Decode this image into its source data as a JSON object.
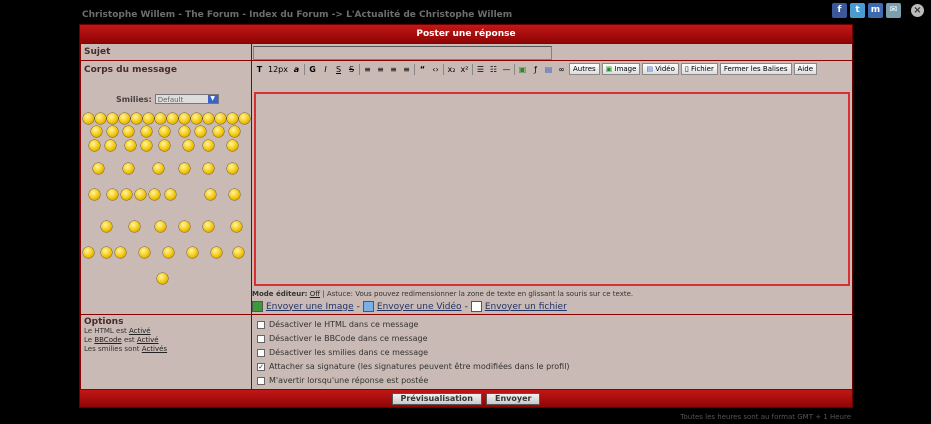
{
  "breadcrumb": "Christophe Willem - The Forum - Index du Forum -> L'Actualité de Christophe Willem",
  "social": [
    {
      "icon": "facebook-icon",
      "glyph": "f",
      "color": "#3b5998"
    },
    {
      "icon": "twitter-icon",
      "glyph": "t",
      "color": "#4a9bd1"
    },
    {
      "icon": "myspace-icon",
      "glyph": "m",
      "color": "#3c6bb4"
    },
    {
      "icon": "mail-icon",
      "glyph": "✉",
      "color": "#7aa0b0"
    }
  ],
  "header": {
    "title": "Poster une réponse"
  },
  "sujet": {
    "label": "Sujet",
    "value": ""
  },
  "corps": {
    "label": "Corps du message"
  },
  "smilies": {
    "label": "Smilies:",
    "selected": "Default"
  },
  "toolbar": {
    "size": "12px",
    "buttons": [
      "Autres",
      "Image",
      "Vidéo",
      "Fichier",
      "Fermer les Balises",
      "Aide"
    ]
  },
  "editor": {
    "mode_label": "Mode éditeur:",
    "mode_value": "Off",
    "tip": "| Astuce: Vous pouvez redimensionner la zone de texte en glissant la souris sur ce texte."
  },
  "uploads": {
    "image": "Envoyer une Image",
    "video": "Envoyer une Vidéo",
    "file": "Envoyer un fichier",
    "sep": "-"
  },
  "options": {
    "title": "Options",
    "html_prefix": "Le HTML est",
    "html_state": "Activé",
    "bbcode_prefix": "Le",
    "bbcode_link": "BBCode",
    "bbcode_mid": "est",
    "bbcode_state": "Activé",
    "smilies_prefix": "Les smilies sont",
    "smilies_state": "Activés",
    "checks": [
      {
        "label": "Désactiver le HTML dans ce message",
        "checked": false
      },
      {
        "label": "Désactiver le BBCode dans ce message",
        "checked": false
      },
      {
        "label": "Désactiver les smilies dans ce message",
        "checked": false
      },
      {
        "label": "Attacher sa signature (les signatures peuvent être modifiées dans le profil)",
        "checked": true
      },
      {
        "label": "M'avertir lorsqu'une réponse est postée",
        "checked": false
      }
    ]
  },
  "actions": {
    "preview": "Prévisualisation",
    "submit": "Envoyer"
  },
  "timezone": "Toutes les heures sont au format GMT + 1 Heure"
}
